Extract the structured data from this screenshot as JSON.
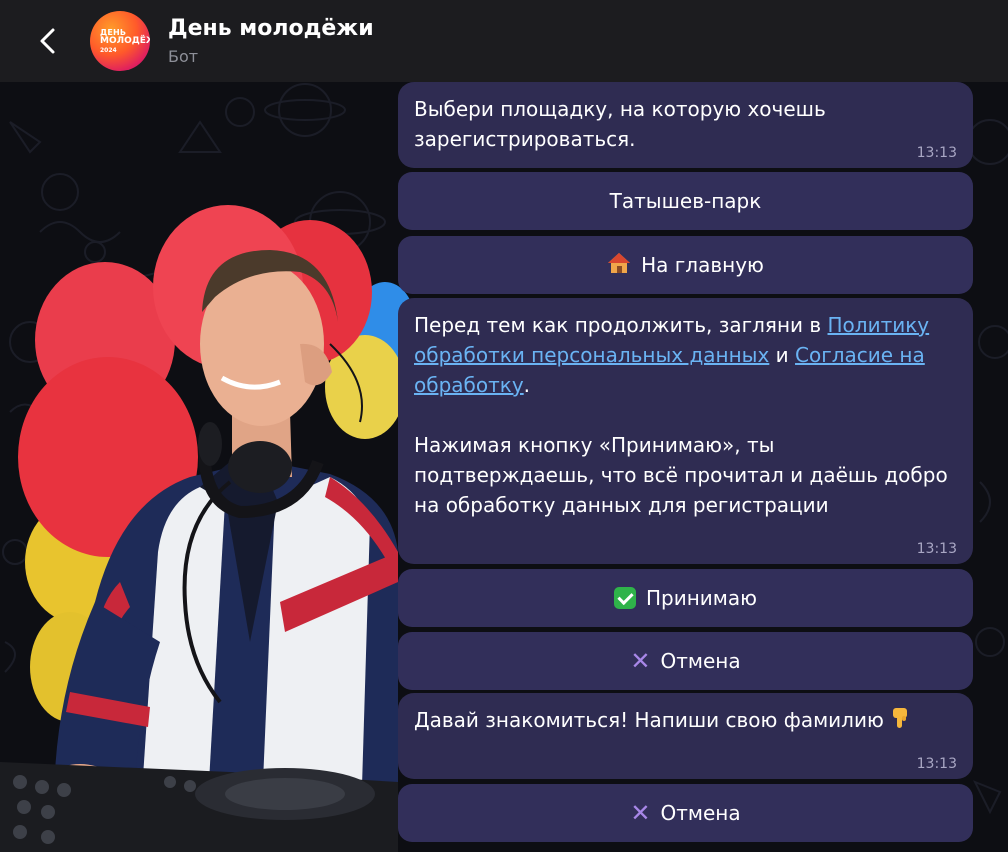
{
  "header": {
    "back_icon": "chevron-left-icon",
    "avatar": {
      "line1": "ДЕНЬ",
      "line2": "МОЛОДЁЖИ",
      "line3": "2024"
    },
    "title": "День молодёжи",
    "subtitle": "Бот"
  },
  "messages": [
    {
      "text": "Выбери площадку, на которую хочешь зарегистрироваться.",
      "time": "13:13"
    },
    {
      "part1": "Перед тем как продолжить, загляни в ",
      "link1": "Политику обработки персональных данных",
      "part2": " и ",
      "link2": "Согласие на обработку",
      "part3": ".",
      "paragraph2": "Нажимая кнопку «Принимаю», ты подтверждаешь, что всё прочитал и даёшь добро на обработку данных для регистрации",
      "time": "13:13"
    },
    {
      "text": "Давай знакомиться! Напиши свою фамилию",
      "emoji": "pointing-down-hand-icon",
      "time": "13:13"
    }
  ],
  "buttons": {
    "park": "Татышев-парк",
    "home": "На главную",
    "home_icon": "house-icon",
    "accept": "Принимаю",
    "accept_icon": "check-mark-button-icon",
    "cancel1": "Отмена",
    "cancel2": "Отмена",
    "cancel_icon": "cross-mark-icon"
  },
  "colors": {
    "header_bg": "#1c1c1f",
    "bubble_bg": "#2f2c52",
    "button_bg": "#322f5a",
    "link": "#6ab3f3",
    "time": "#a9a7c4"
  }
}
